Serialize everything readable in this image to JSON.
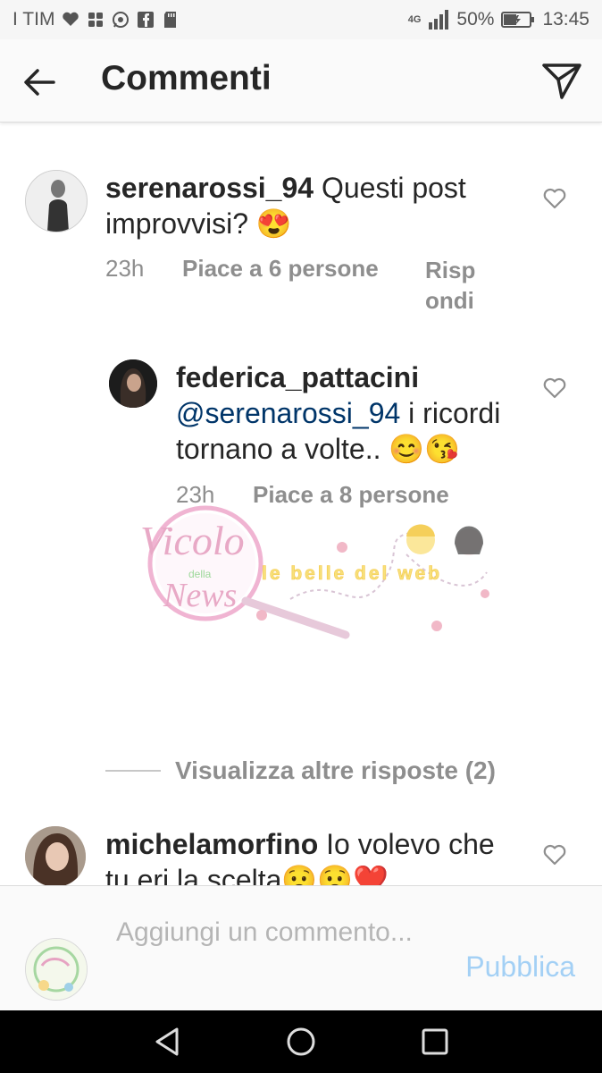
{
  "status_bar": {
    "carrier": "I TIM",
    "network": "4G",
    "battery": "50%",
    "time": "13:45"
  },
  "header": {
    "title": "Commenti"
  },
  "comments": [
    {
      "username": "serenarossi_94",
      "text": " Questi post improvvisi? 😍",
      "time": "23h",
      "likes": "Piace a 6 persone",
      "reply_line1": "Risp",
      "reply_line2": "ondi"
    },
    {
      "username": "federica_pattacini",
      "mention": "@serenarossi_94",
      "text": " i ricordi tornano a volte.. 😊😘",
      "time": "23h",
      "likes": "Piace a 8 persone"
    },
    {
      "username": "michelamorfino",
      "text": " Io volevo che tu eri la scelta😧😧❤️"
    }
  ],
  "view_replies": "Visualizza altre risposte (2)",
  "watermark_text": {
    "brand1": "Vicolo",
    "brand2": "della",
    "brand3": "News",
    "tagline": "le belle del web"
  },
  "input": {
    "placeholder": "Aggiungi un commento...",
    "publish_label": "Pubblica"
  },
  "colors": {
    "username": "#262626",
    "meta": "#8e8e8e",
    "mention": "#003569",
    "publish_disabled": "#a3d0f5"
  }
}
